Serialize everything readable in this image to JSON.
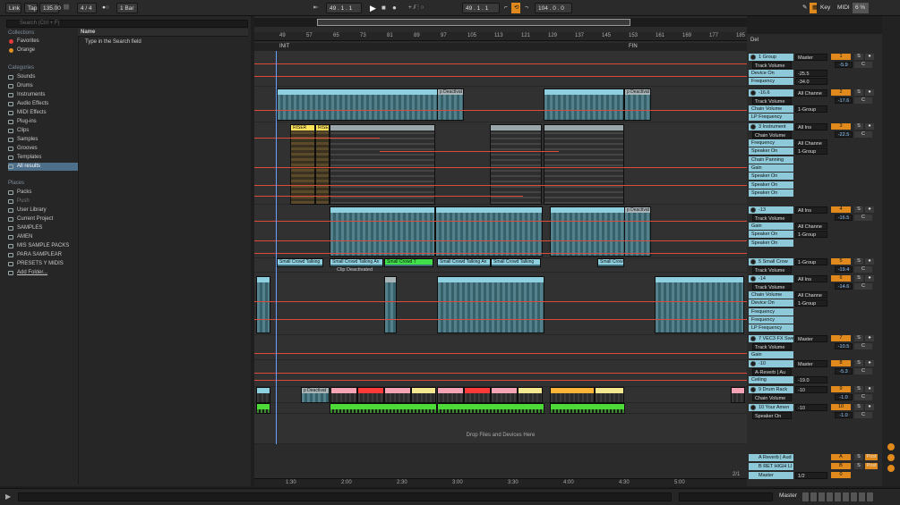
{
  "topbar": {
    "link": "Link",
    "tap": "Tap",
    "tempo": "135.00",
    "signature": "4 / 4",
    "bar_quant": "1 Bar",
    "position": "49 .  1 .  1",
    "loop_start": "49 .  1 .  1",
    "loop_length": "104 .  0 .  0",
    "key": "Key",
    "midi": "MIDI",
    "cpu": "6 %"
  },
  "browser": {
    "search_placeholder": "Search (Ctrl + F)",
    "collections_title": "Collections",
    "collections": [
      {
        "label": "Favorites",
        "color": "#e53a3a"
      },
      {
        "label": "Orange",
        "color": "#e0901e"
      }
    ],
    "categories_title": "Categories",
    "categories": [
      "Sounds",
      "Drums",
      "Instruments",
      "Audio Effects",
      "MIDI Effects",
      "Plug-ins",
      "Clips",
      "Samples",
      "Grooves",
      "Templates",
      "All results"
    ],
    "places_title": "Places",
    "places": [
      "Packs",
      "Push",
      "User Library",
      "Current Project",
      "SAMPLES",
      "AMEN",
      "MIS SAMPLE PACKS",
      "PARA SAMPLEAR",
      "PRESETS Y MIDIS",
      "Add Folder..."
    ],
    "name_header": "Name",
    "hint": "Type in the Search field"
  },
  "arrangement": {
    "ruler": [
      "49",
      "57",
      "65",
      "73",
      "81",
      "89",
      "97",
      "105",
      "113",
      "121",
      "129",
      "137",
      "145",
      "153",
      "161",
      "169",
      "177",
      "185"
    ],
    "marker_start": "INIT",
    "marker_end": "FIN",
    "clip_labels": {
      "riser1": "RISER",
      "riser2": "RISER",
      "deact": "p Deactivat",
      "small1": "Small Crowd Talking",
      "small2": "Small Crowd Talking An",
      "small3": "Small Crowd T",
      "small4": "Small Crowd Talking An",
      "small5": "Small Crowd Talking",
      "small6": "Small Crow",
      "clip_deact": "Clip Deactivated",
      "drop": "Drop Files and Devices Here"
    },
    "times": [
      "1:30",
      "2:00",
      "2:30",
      "3:00",
      "3:30",
      "4:00",
      "4:30",
      "5:00"
    ],
    "zoom": "2/1"
  },
  "mixer": {
    "tracks": [
      {
        "name": "1 Group",
        "out": "Master",
        "num": "1",
        "vol": "-5.9",
        "pan": "C",
        "dev": "Track Volume",
        "params": [
          "Device On",
          "Frequency"
        ],
        "extra": [
          "-25.5",
          "-34.0"
        ]
      },
      {
        "name": "-16.6",
        "out": "All Channe",
        "num": "2",
        "vol": "-17.6",
        "pan": "C",
        "dev": "Track Volume",
        "params": [
          "Chain Volume",
          "LP Frequency"
        ],
        "extra": [
          "1-Group"
        ]
      },
      {
        "name": "3 Instrument",
        "out": "All Ins",
        "num": "3",
        "vol": "-22.5",
        "pan": "C",
        "dev": "Chain Volume",
        "params": [
          "Frequency",
          "Speaker On",
          "Chain Panning",
          "Gain",
          "Speaker On",
          "Speaker On",
          "Speaker On"
        ],
        "extra": [
          "All Channe",
          "1-Group"
        ]
      },
      {
        "name": "-13",
        "out": "All Ins",
        "num": "4",
        "vol": "-16.5",
        "pan": "C",
        "dev": "Track Volume",
        "params": [
          "Gain",
          "Speaker On",
          "Speaker On"
        ],
        "extra": [
          "All Channe",
          "1-Group"
        ]
      },
      {
        "name": "5 Small Crow",
        "out": "1-Group",
        "num": "5",
        "vol": "-19.4",
        "pan": "C",
        "dev": "Track Volume",
        "params": [],
        "extra": []
      },
      {
        "name": "-14",
        "out": "All Ins",
        "num": "6",
        "vol": "-14.6",
        "pan": "C",
        "dev": "Track Volume",
        "params": [
          "Chain Volume",
          "Device On",
          "Frequency",
          "Frequency",
          "LP Frequency"
        ],
        "extra": [
          "All Channe",
          "1-Group"
        ]
      },
      {
        "name": "7 VEC3 FX Swe",
        "out": "Master",
        "num": "7",
        "vol": "-10.5",
        "pan": "C",
        "dev": "Track Volume",
        "params": [
          "Gain"
        ],
        "extra": []
      },
      {
        "name": "-10",
        "out": "Master",
        "num": "8",
        "vol": "-5.3",
        "pan": "C",
        "dev": "A-Reverb | Au",
        "params": [
          "Ceiling"
        ],
        "extra": [
          "-19.0"
        ]
      },
      {
        "name": "9 Drum Rack",
        "out": "-10",
        "num": "9",
        "vol": "-1.0",
        "pan": "C",
        "dev": "Chain Volume",
        "params": [],
        "extra": []
      },
      {
        "name": "10 Your Amen",
        "out": "-10",
        "num": "10",
        "vol": "-1.0",
        "pan": "C",
        "dev": "Speaker On",
        "params": [],
        "extra": []
      }
    ],
    "returns": [
      {
        "name": "A Reverb | Aud",
        "num": "A",
        "send": "Post"
      },
      {
        "name": "B RET HIGH LI",
        "num": "B",
        "send": "Post"
      }
    ],
    "master": {
      "name": "Master",
      "out": "1/2",
      "num": "0"
    }
  },
  "status": {
    "master_label": "Master"
  }
}
